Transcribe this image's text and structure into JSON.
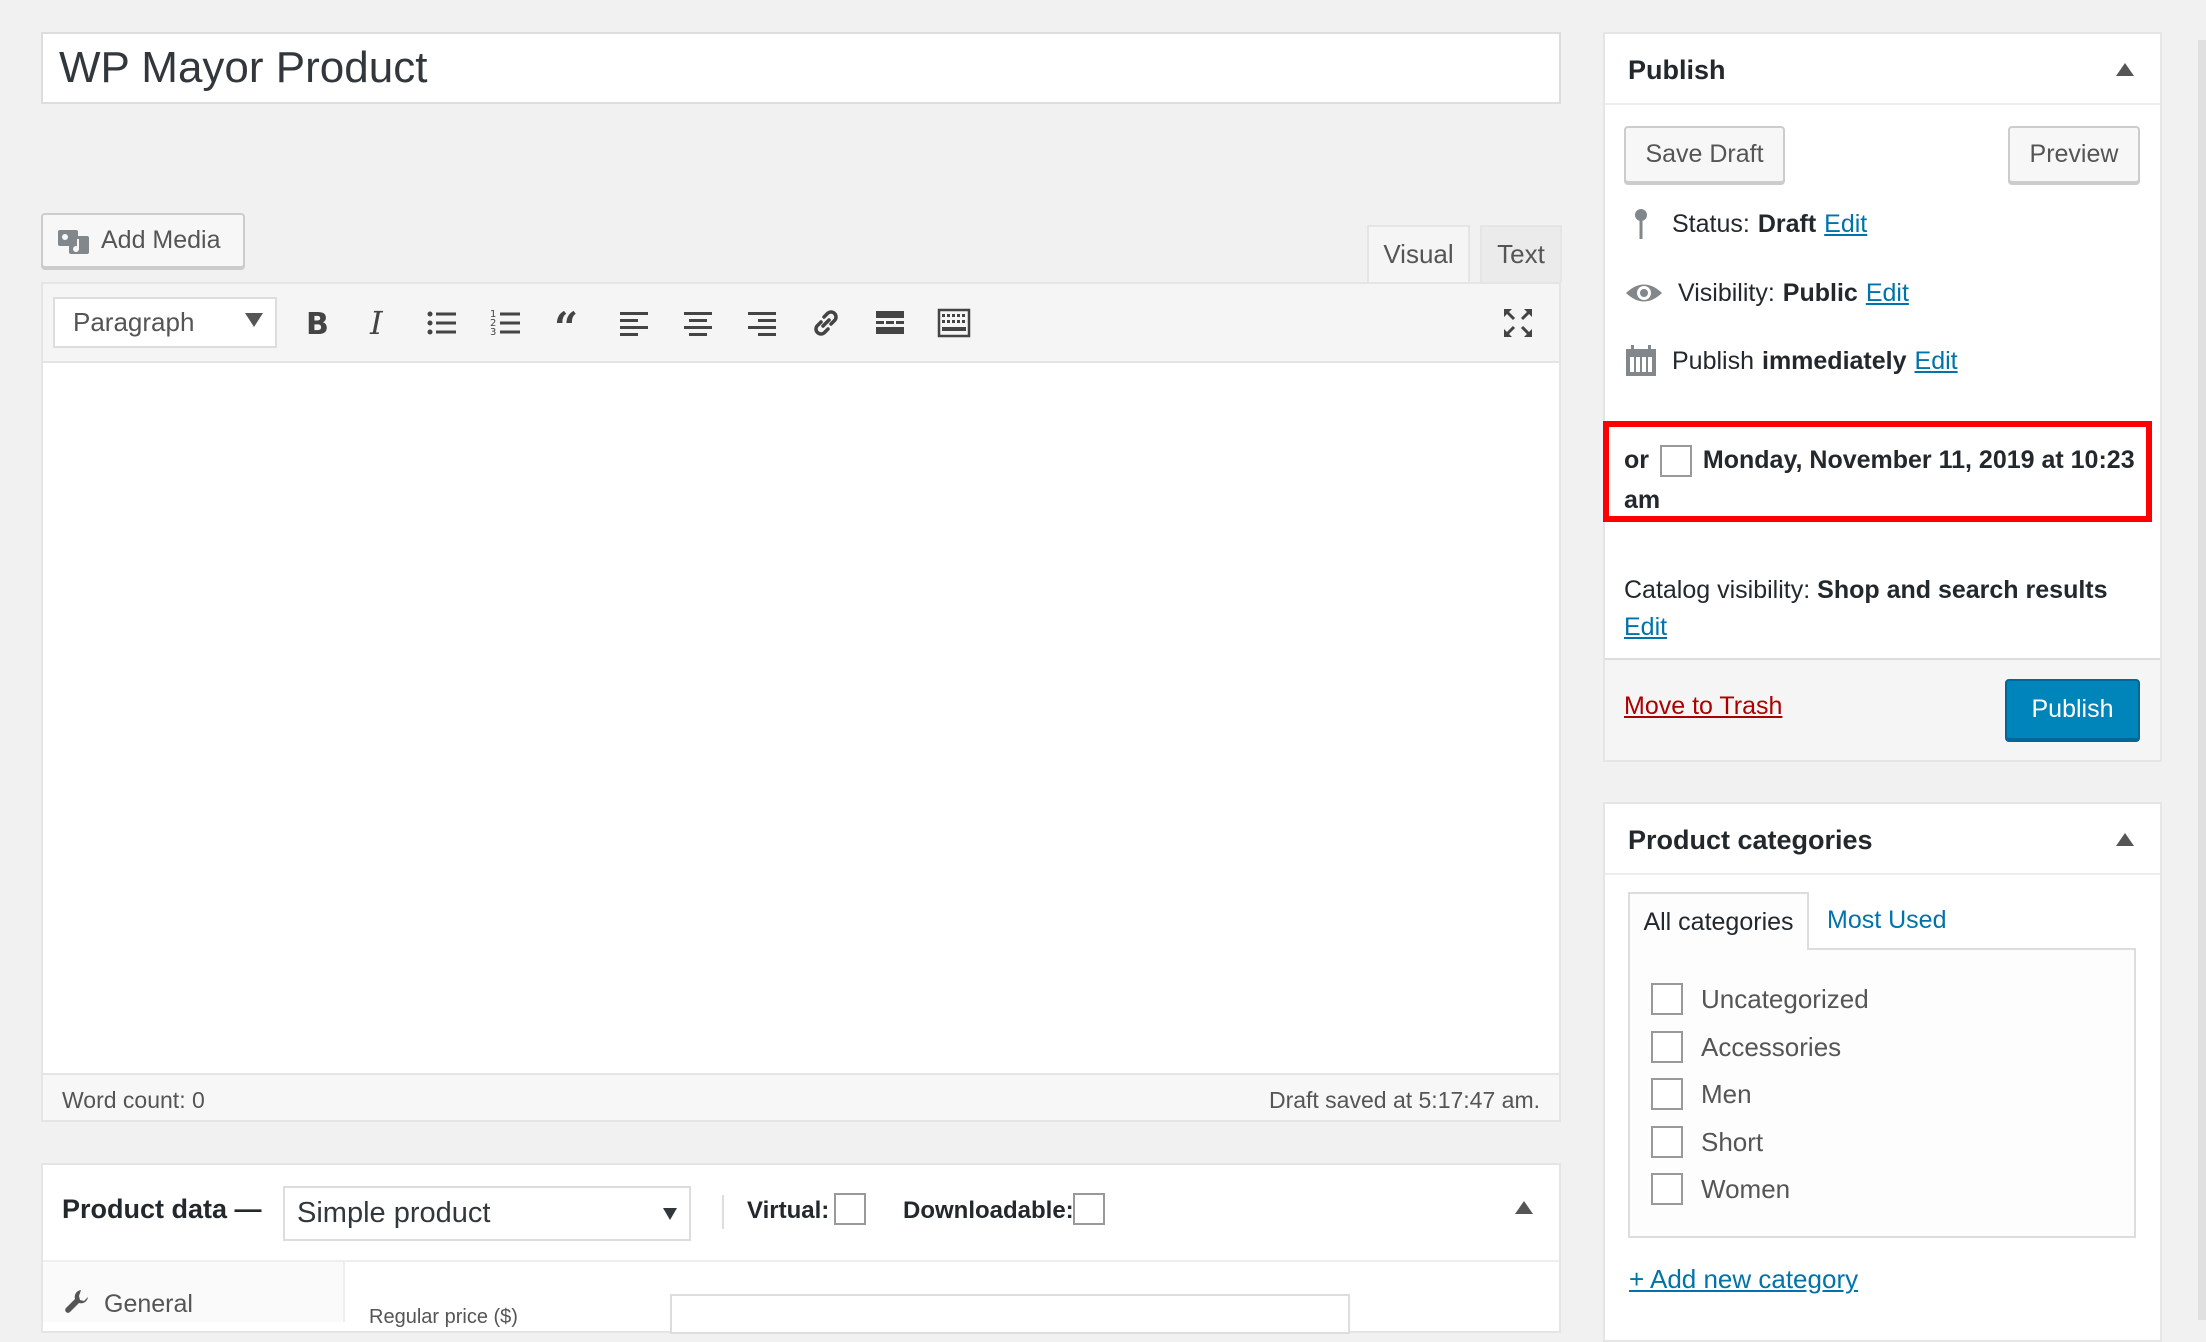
{
  "post": {
    "title": "WP Mayor Product"
  },
  "editor": {
    "add_media_label": "Add Media",
    "tab_visual": "Visual",
    "tab_text": "Text",
    "format_select": "Paragraph",
    "word_count": "Word count: 0",
    "draft_saved": "Draft saved at 5:17:47 am."
  },
  "product_data": {
    "title": "Product data —",
    "type_select": "Simple product",
    "virtual_label": "Virtual:",
    "downloadable_label": "Downloadable:",
    "general_tab": "General",
    "regular_price_label": "Regular price ($)"
  },
  "publish": {
    "title": "Publish",
    "save_draft": "Save Draft",
    "preview": "Preview",
    "status_label": "Status:",
    "status_value": "Draft",
    "visibility_label": "Visibility:",
    "visibility_value": "Public",
    "publish_label": "Publish",
    "publish_value": "immediately",
    "edit": "Edit",
    "schedule_prefix": "or",
    "schedule_text": "Monday, November 11, 2019 at 10:23 am",
    "catalog_label": "Catalog visibility:",
    "catalog_value": "Shop and search results",
    "move_to_trash": "Move to Trash",
    "publish_button": "Publish"
  },
  "categories": {
    "title": "Product categories",
    "tab_all": "All categories",
    "tab_most_used": "Most Used",
    "items": [
      "Uncategorized",
      "Accessories",
      "Men",
      "Short",
      "Women"
    ],
    "add_new": "+ Add new category"
  },
  "colors": {
    "accent": "#0073aa",
    "primary_button": "#0085ba",
    "trash": "#a00",
    "highlight": "#ff0000"
  }
}
